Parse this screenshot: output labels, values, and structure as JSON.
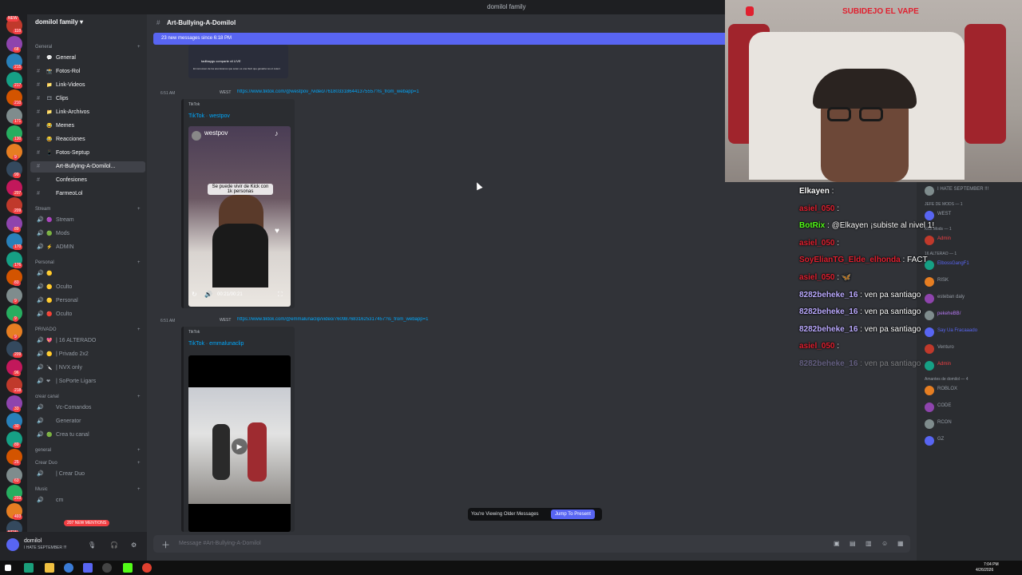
{
  "window": {
    "title": "domilol family"
  },
  "server_rail": {
    "badges": [
      "NEW",
      "NEW"
    ],
    "counts": [
      "118",
      "68",
      "215",
      "217",
      "210",
      "171",
      "130",
      "9",
      "99",
      "207",
      "209",
      "89",
      "170",
      "176",
      "83",
      "9",
      "9",
      "9",
      "209",
      "96",
      "218",
      "33",
      "30",
      "89",
      "25",
      "63",
      "203",
      "493",
      "9"
    ]
  },
  "sidebar": {
    "guild_name": "domilol family",
    "categories": [
      {
        "label": "General",
        "channels": [
          {
            "emoji": "💬",
            "label": "General"
          },
          {
            "emoji": "📸",
            "label": "Fotos-Rol"
          },
          {
            "emoji": "📁",
            "label": "Link-Videos"
          },
          {
            "emoji": "🎞",
            "label": "Clips"
          },
          {
            "emoji": "📁",
            "label": "Link-Archivos"
          },
          {
            "emoji": "😂",
            "label": "Memes"
          },
          {
            "emoji": "😂",
            "label": "Reacciones"
          },
          {
            "emoji": "📱",
            "label": "Fotos-Septup"
          },
          {
            "emoji": "",
            "label": "Art-Bullying-A-Domilol..."
          },
          {
            "emoji": "",
            "label": "Confesiones"
          },
          {
            "emoji": "",
            "label": "FarmeoLol"
          }
        ]
      },
      {
        "label": "Stream",
        "channels": [
          {
            "emoji": "🟣",
            "label": "Stream"
          },
          {
            "emoji": "🟢",
            "label": "Mods"
          },
          {
            "emoji": "⚡",
            "label": "ADMIN"
          }
        ]
      },
      {
        "label": "Personal",
        "channels": [
          {
            "emoji": "🟡",
            "label": ""
          },
          {
            "emoji": "🟡",
            "label": "Oculto"
          },
          {
            "emoji": "🟡",
            "label": "Personal"
          },
          {
            "emoji": "🔴",
            "label": "Oculto"
          }
        ]
      },
      {
        "label": "PRIVADO",
        "channels": [
          {
            "emoji": "💖",
            "label": "| 16 ALTERADO"
          },
          {
            "emoji": "🟡",
            "label": "| Privado 2x2"
          },
          {
            "emoji": "🔪",
            "label": "| NVX only"
          },
          {
            "emoji": "❤",
            "label": "| SoPorte Ligars"
          }
        ]
      },
      {
        "label": "crear canal",
        "channels": [
          {
            "emoji": "",
            "label": "Vc-Comandos"
          },
          {
            "emoji": "",
            "label": "Generator"
          },
          {
            "emoji": "🟢",
            "label": "Crea tu canal"
          }
        ]
      },
      {
        "label": "general",
        "channels": []
      },
      {
        "label": "Crear Duo",
        "channels": [
          {
            "emoji": "",
            "label": "| Crear Duo"
          }
        ]
      },
      {
        "label": "Music",
        "channels": [
          {
            "emoji": "",
            "label": "cm"
          }
        ]
      }
    ],
    "mentions_pill": "207 NEW MENTIONS"
  },
  "user_panel": {
    "name": "domilol",
    "status": "I HATE SEPTEMBER !!!"
  },
  "header": {
    "channel_name": "Art-Bullying-A-Domilol"
  },
  "new_messages_bar": "23 new messages since 6:18 PM",
  "messages": [
    {
      "caption_top": "tadibaygs comparte vil LIVE",
      "caption_sub": "El comocoen de los anomicanos que soten es una IGvit que ganadrer as ol colect"
    },
    {
      "time": "6:51 AM",
      "prefix": "WEST",
      "link": "https://www.tiktok.com/@westpov_/video/7618033186441375557?is_from_webapp=1",
      "provider": "TikTok",
      "title": "TikTok · westpov",
      "handle": "westpov",
      "caption": "Se puede vivir de Kick con 1k personas",
      "time_code": "00:21/00:21"
    },
    {
      "time": "6:51 AM",
      "prefix": "WEST",
      "link": "https://www.tiktok.com/@emmalunaclip/video/7609876831625317457?is_from_webapp=1",
      "provider": "TikTok",
      "title": "TikTok · emmalunaclip"
    }
  ],
  "older_bar": {
    "text": "You're Viewing Older Messages",
    "button": "Jump To Present"
  },
  "composer": {
    "placeholder": "Message #Art-Bullying-A-Domilol"
  },
  "webcam": {
    "title": "SUBIDEJO EL VAPE"
  },
  "chat_overlay": [
    {
      "user": "Elkayen",
      "sep": ":",
      "message": "",
      "color": "#ffffff"
    },
    {
      "user": "asiel_050",
      "sep": ":",
      "message": "",
      "color": "#e02030"
    },
    {
      "user": "BotRix",
      "sep": ":",
      "message": "@Elkayen ¡subiste al nivel 1!",
      "color": "#53fc18"
    },
    {
      "user": "asiel_050",
      "sep": ":",
      "message": "",
      "color": "#e02030"
    },
    {
      "user": "SoyElianTG_Elde_elhonda",
      "sep": ":",
      "message": "FACT",
      "color": "#e02030"
    },
    {
      "user": "asiel_050",
      "sep": ":",
      "message": "🦋",
      "color": "#e02030"
    },
    {
      "user": "8282beheke_16",
      "sep": ":",
      "message": "ven pa santiago",
      "color": "#bbaaff"
    },
    {
      "user": "8282beheke_16",
      "sep": ":",
      "message": "ven pa santiago",
      "color": "#bbaaff"
    },
    {
      "user": "8282beheke_16",
      "sep": ":",
      "message": "ven pa santiago",
      "color": "#bbaaff"
    },
    {
      "user": "asiel_050",
      "sep": ":",
      "message": "",
      "color": "#e02030"
    },
    {
      "user": "8282beheke_16",
      "sep": ":",
      "message": "ven pa santiago",
      "color": "#bbaaff"
    }
  ],
  "members": {
    "sections": [
      {
        "label": "JEFE DE MODS — 1"
      },
      {
        "label": "Kick Mods — 1"
      },
      {
        "label": "16 ALTERAO — 1"
      },
      {
        "label": "Amantes de domilol — 4"
      }
    ],
    "rows": [
      {
        "name": "I HATE SEPTEMBER !!!",
        "color": "#949ba4"
      },
      {
        "name": "WEST",
        "color": "#949ba4"
      },
      {
        "name": "Admin",
        "color": "#f23f43"
      },
      {
        "name": "ElbossGangF1",
        "color": "#5865f2"
      },
      {
        "name": "RISK",
        "color": "#949ba4"
      },
      {
        "name": "esteban daly",
        "color": "#949ba4"
      },
      {
        "name": "pekeheBB/",
        "color": "#b678f2"
      },
      {
        "name": "Say Ua Fracaaado",
        "color": "#5865f2"
      },
      {
        "name": "Venturo",
        "color": "#949ba4"
      },
      {
        "name": "Admin",
        "color": "#f23f43"
      },
      {
        "name": "ROBLOX",
        "color": "#949ba4"
      },
      {
        "name": "CODE",
        "color": "#949ba4"
      },
      {
        "name": "RCON",
        "color": "#949ba4"
      },
      {
        "name": "GZ",
        "color": "#949ba4"
      }
    ]
  },
  "taskbar": {
    "time": "7:04 PM",
    "date": "4/26/2026"
  },
  "colors": {
    "blurple": "#5865f2",
    "danger": "#f23f43",
    "link": "#00a8fc",
    "kick_green": "#53fc18"
  }
}
